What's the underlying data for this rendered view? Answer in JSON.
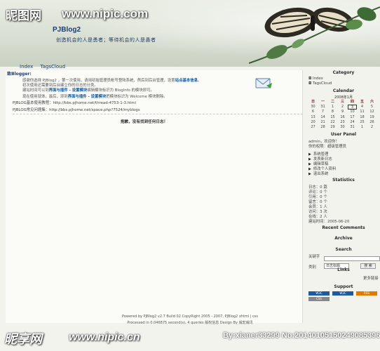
{
  "watermark": {
    "top_logo": "昵图网",
    "top_url": "www.nipic.com",
    "bottom_logo": "昵享网",
    "bottom_url": "www.nipic.cn",
    "bottom_id": "By:xianer33299 No:20140105150249085396"
  },
  "header": {
    "title": "PJBlog2",
    "subtitle": "创造机会的人是勇者；等待机会的人是愚者"
  },
  "nav": {
    "items": [
      "Index",
      "TagsCloud"
    ]
  },
  "main": {
    "greeting": "致Blogger:",
    "paragraphs": [
      "感谢你选择 PJBlog2 ，第一次使用，请用初始管理员帐号登陆系统，然后到后台管理，设置",
      "站点基本信息",
      "。",
      "初次使用还需要到后台建立你的日志的分类。",
      "建站时间可以到",
      "界面与插件 - 设置模块",
      "编辑模块标识为 BlogInfo 的模块即可。",
      "现在使用就体，最后，添到",
      "界面与插件 - 设置模块",
      "把模块标识为 Welcome 模块删除。"
    ],
    "links": [
      "PJBLOG基本使用教程：http://bbs.pjhome.net/thread-4753-1-3.html",
      "PJBLOG常见问题集：http://bbs.pjhome.net/space.php?7524/myblogs"
    ],
    "center_note": "抱歉，没有找到任何日志！"
  },
  "sidebar": {
    "category_title": "Category",
    "category_items": [
      "Index",
      "TagsCloud"
    ],
    "calendar_title": "Calendar",
    "calendar_caption": "2008年1月",
    "calendar_head": [
      "日",
      "一",
      "二",
      "三",
      "四",
      "五",
      "六"
    ],
    "calendar_rows": [
      [
        "30",
        "31",
        "1",
        "2",
        "3",
        "4",
        "5"
      ],
      [
        "6",
        "7",
        "8",
        "9",
        "10",
        "11",
        "12"
      ],
      [
        "13",
        "14",
        "15",
        "16",
        "17",
        "18",
        "19"
      ],
      [
        "20",
        "21",
        "22",
        "23",
        "24",
        "25",
        "26"
      ],
      [
        "27",
        "28",
        "29",
        "30",
        "31",
        "1",
        "2"
      ]
    ],
    "user_title": "User Panel",
    "user_line1": "admin，欢迎你！",
    "user_line2": "你的权限：超级管理员",
    "user_menu": [
      "系统管理",
      "发表新日志",
      "编辑草稿",
      "修改个人资料",
      "退出系统"
    ],
    "stats_title": "Statistics",
    "stats": [
      "日志：0 篇",
      "评论：0 个",
      "引用：0 个",
      "留言：0 个",
      "会员：1 人",
      "访问：3 次",
      "在线：2 人",
      "建站时间：2005-06-20"
    ],
    "recent_title": "Recent Comments",
    "archive_title": "Archive",
    "search_title": "Search",
    "search_label": "关键字",
    "search_type_label": "类别",
    "search_select": "日志标题",
    "search_button": "搜 索",
    "links_title": "Links",
    "links_more": "更多链接",
    "support_title": "Support",
    "badges": [
      "W3C",
      "W3C",
      "RSS",
      "CSS"
    ]
  },
  "footer": {
    "line1": "Powered by PJBlog2 v2.7 Build 02 CopyRight 2005 - 2007, PJBlog2 xhtml | css",
    "line2": "Processed in 0.046875 second(s), 4 queries   版权信息   Design By 威宏威讯"
  }
}
